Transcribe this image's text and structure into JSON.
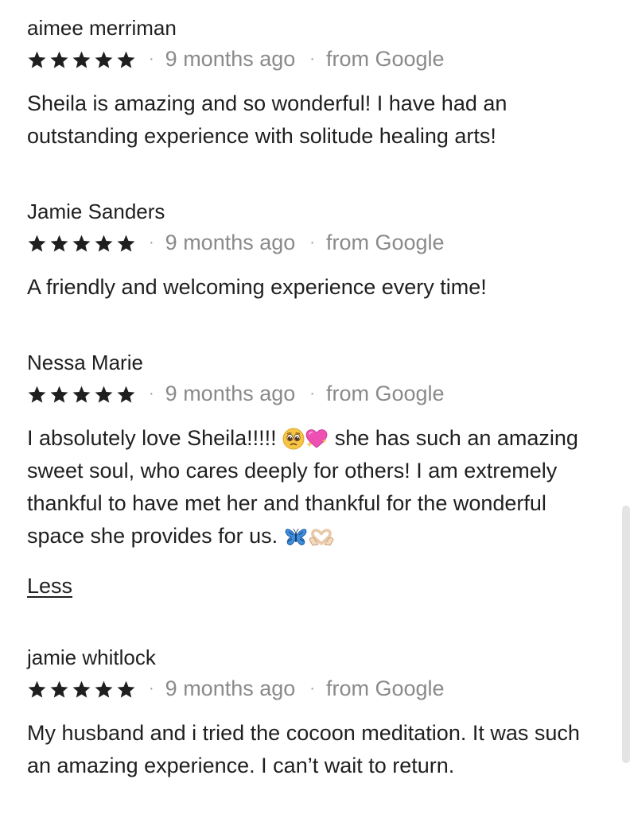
{
  "reviews": [
    {
      "name": "aimee merriman",
      "rating": 5,
      "age": "9 months ago",
      "source": "from Google",
      "text": "Sheila is amazing and so wonderful! I have had an outstanding experience with solitude healing arts!"
    },
    {
      "name": "Jamie Sanders",
      "rating": 5,
      "age": "9 months ago",
      "source": "from Google",
      "text": "A friendly and welcoming experience every time!"
    },
    {
      "name": "Nessa Marie",
      "rating": 5,
      "age": "9 months ago",
      "source": "from Google",
      "text_before_emoji": "I absolutely love Sheila!!!!!",
      "emoji_1": [
        "pleading-face-icon",
        "heart-with-sparkles-icon"
      ],
      "text_after_emoji": "she has such an amazing sweet soul, who cares deeply for others! I am extremely thankful to have met her and thankful for the wonderful space she provides for us.",
      "emoji_2": [
        "butterfly-icon",
        "heart-hands-icon"
      ],
      "less_label": "Less"
    },
    {
      "name": "jamie whitlock",
      "rating": 5,
      "age": "9 months ago",
      "source": "from Google",
      "text": "My husband and i tried the cocoon meditation. It was such an amazing experience. I can’t wait to return."
    }
  ],
  "separator": "·",
  "colors": {
    "text": "#1f1f1f",
    "meta": "#8a8a8a",
    "star": "#1f1f1f",
    "scrollbar": "#e4e4e4"
  }
}
